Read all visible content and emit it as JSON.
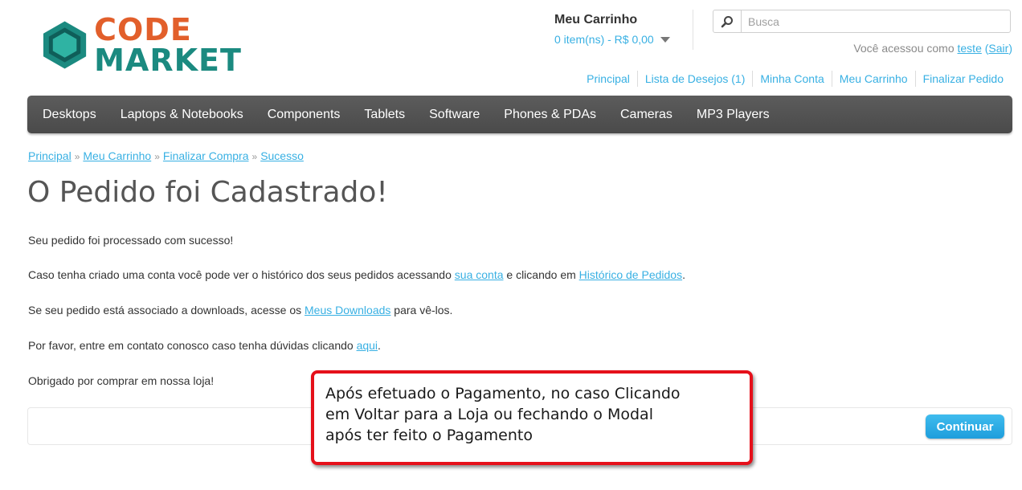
{
  "logo": {
    "word1": "CODE",
    "word2": "MARKET",
    "icon": "hexagon-logo-icon",
    "colors": {
      "code": "#e25f2b",
      "market": "#1b8a80"
    }
  },
  "cart": {
    "title": "Meu Carrinho",
    "summary": "0 item(ns) - R$ 0,00"
  },
  "search": {
    "placeholder": "Busca",
    "icon": "search-icon"
  },
  "welcome": {
    "prefix": "Você acessou como",
    "username": "teste",
    "open_paren": "(",
    "logout": "Sair",
    "close_paren": ")"
  },
  "top_links": [
    "Principal",
    "Lista de Desejos (1)",
    "Minha Conta",
    "Meu Carrinho",
    "Finalizar Pedido"
  ],
  "menu": [
    "Desktops",
    "Laptops & Notebooks",
    "Components",
    "Tablets",
    "Software",
    "Phones & PDAs",
    "Cameras",
    "MP3 Players"
  ],
  "breadcrumb": {
    "separator": "»",
    "items": [
      "Principal",
      "Meu Carrinho",
      "Finalizar Compra",
      "Sucesso"
    ]
  },
  "page_title": "O Pedido foi Cadastrado!",
  "content": {
    "p1": "Seu pedido foi processado com sucesso!",
    "p2_a": "Caso tenha criado uma conta você pode ver o histórico dos seus pedidos acessando",
    "p2_link1": "sua conta",
    "p2_b": "e clicando em",
    "p2_link2": "Histórico de Pedidos",
    "p2_c": ".",
    "p3_a": "Se seu pedido está associado a downloads, acesse os",
    "p3_link": "Meus Downloads",
    "p3_b": "para vê-los.",
    "p4_a": "Por favor, entre em contato conosco caso tenha dúvidas clicando",
    "p4_link": "aqui",
    "p4_b": ".",
    "p5": "Obrigado por comprar em nossa loja!"
  },
  "continue_button": "Continuar",
  "callout": {
    "text": "Após efetuado o Pagamento, no caso Clicando\nem Voltar para a Loja ou fechando o Modal\napós ter feito o Pagamento",
    "border_color": "#e5101a"
  }
}
